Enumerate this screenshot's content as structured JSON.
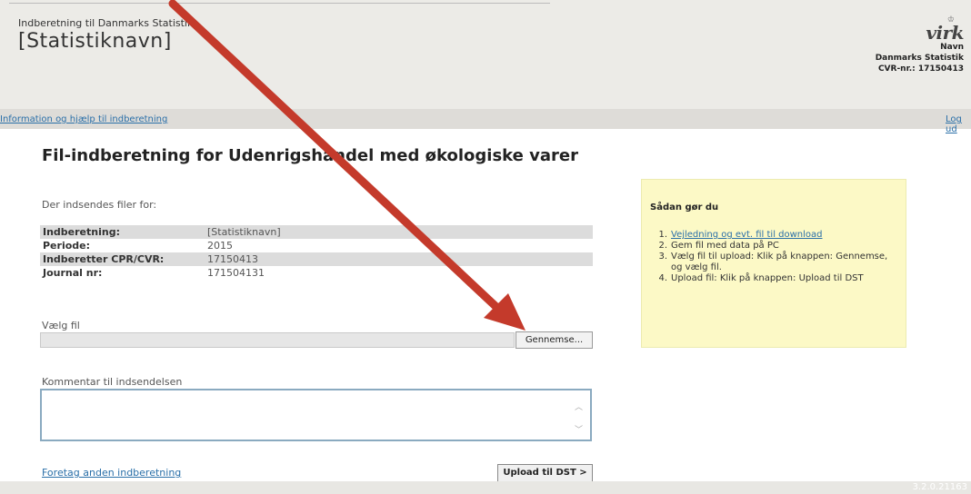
{
  "header": {
    "app_title": "Indberetning til Danmarks Statistik",
    "stat_name": "[Statistiknavn]",
    "brand_logo": "virk",
    "user_name": "Navn",
    "org_name": "Danmarks Statistik",
    "cvr": "CVR-nr.: 17150413"
  },
  "nav": {
    "help_link": "Information og hjælp til indberetning",
    "logout_link": "Log ud"
  },
  "main": {
    "title": "Fil-indberetning for Udenrigshandel med økologiske varer",
    "submit_for": "Der indsendes filer for:",
    "info_rows": [
      {
        "label": "Indberetning:",
        "value": "[Statistiknavn]"
      },
      {
        "label": "Periode:",
        "value": "2015"
      },
      {
        "label": "Indberetter CPR/CVR:",
        "value": "17150413"
      },
      {
        "label": "Journal nr:",
        "value": "171504131"
      }
    ],
    "file_label": "Vælg fil",
    "file_value": "",
    "browse_button": "Gennemse...",
    "comment_label": "Kommentar til indsendelsen",
    "comment_value": "",
    "other_link": "Foretag anden indberetning",
    "upload_button": "Upload til DST >"
  },
  "help": {
    "title": "Sådan gør du",
    "items": [
      {
        "num": "1.",
        "text": "Vejledning og evt. fil til download"
      },
      {
        "num": "2.",
        "text": "Gem fil med data på PC"
      },
      {
        "num": "3.",
        "text": "Vælg fil til upload: Klik på knappen: Gennemse, og vælg fil."
      },
      {
        "num": "4.",
        "text": "Upload fil: Klik på knappen: Upload til DST"
      }
    ]
  },
  "footer": {
    "version": "3.2.0.21163"
  },
  "icons": {
    "scroll_up": "chevron-up-icon",
    "scroll_down": "chevron-down-icon",
    "annotation": "red-arrow-icon"
  },
  "colors": {
    "link": "#2a6fa8",
    "help_box": "#fcf9c6",
    "arrow": "#c43a2b"
  }
}
